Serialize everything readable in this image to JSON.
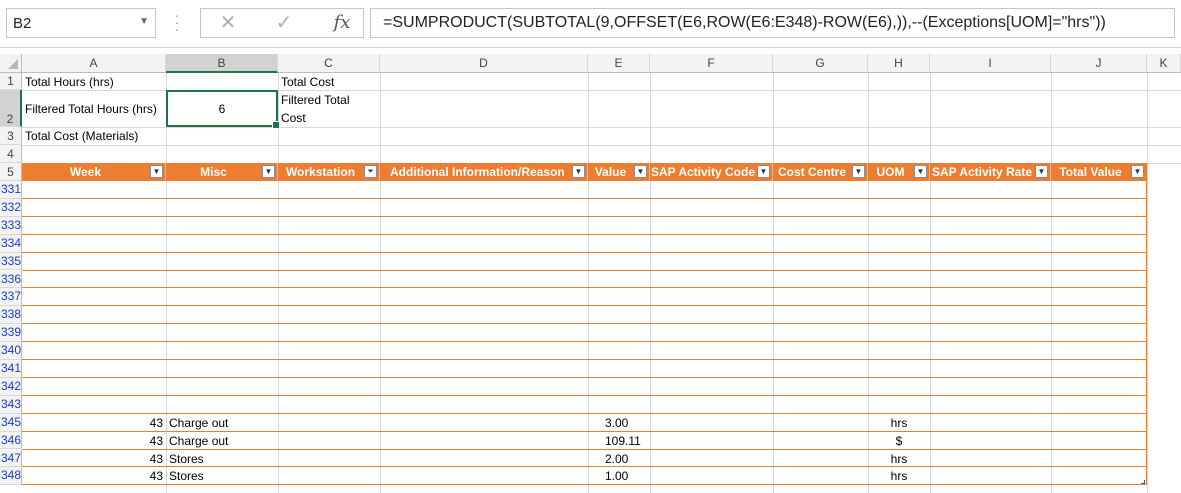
{
  "formula_bar": {
    "name_box": "B2",
    "formula": "=SUMPRODUCT(SUBTOTAL(9,OFFSET(E6,ROW(E6:E348)-ROW(E6),)),--(Exceptions[UOM]=\"hrs\"))",
    "cancel_glyph": "✕",
    "enter_glyph": "✓",
    "fx_label": "fx"
  },
  "columns": [
    "A",
    "B",
    "C",
    "D",
    "E",
    "F",
    "G",
    "H",
    "I",
    "J",
    "K"
  ],
  "selected_column": "B",
  "selected_row": "2",
  "top_rows": [
    "1",
    "2",
    "3",
    "4",
    "5"
  ],
  "cells": {
    "A1": "Total Hours (hrs)",
    "C1": "Total Cost",
    "A2": "Filtered Total Hours (hrs)",
    "B2": "6",
    "C2_line1": "Filtered Total",
    "C2_line2": "Cost",
    "A3": "Total Cost (Materials)"
  },
  "table_headers": [
    {
      "label": "Week",
      "filter": "dropdown"
    },
    {
      "label": "Misc",
      "filter": "dropdown"
    },
    {
      "label": "Workstation",
      "filter": "filtered"
    },
    {
      "label": "Additional Information/Reason",
      "filter": "dropdown"
    },
    {
      "label": "Value",
      "filter": "dropdown"
    },
    {
      "label": "SAP Activity Code",
      "filter": "dropdown"
    },
    {
      "label": "Cost Centre",
      "filter": "dropdown"
    },
    {
      "label": "UOM",
      "filter": "dropdown"
    },
    {
      "label": "SAP Activity Rate",
      "filter": "dropdown"
    },
    {
      "label": "Total Value",
      "filter": "dropdown"
    }
  ],
  "empty_rows": [
    "331",
    "332",
    "333",
    "334",
    "335",
    "336",
    "337",
    "338",
    "339",
    "340",
    "341",
    "342",
    "343"
  ],
  "data_rows": [
    {
      "row": "345",
      "week": "43",
      "misc": "Charge out",
      "value": "3.00",
      "uom": "hrs"
    },
    {
      "row": "346",
      "week": "43",
      "misc": "Charge out",
      "value": "109.11",
      "uom": "$"
    },
    {
      "row": "347",
      "week": "43",
      "misc": "Stores",
      "value": "2.00",
      "uom": "hrs"
    },
    {
      "row": "348",
      "week": "43",
      "misc": "Stores",
      "value": "1.00",
      "uom": "hrs"
    }
  ],
  "colors": {
    "table_header": "#ED7D31",
    "selection": "#217346",
    "row_link": "#1A3CCC"
  }
}
